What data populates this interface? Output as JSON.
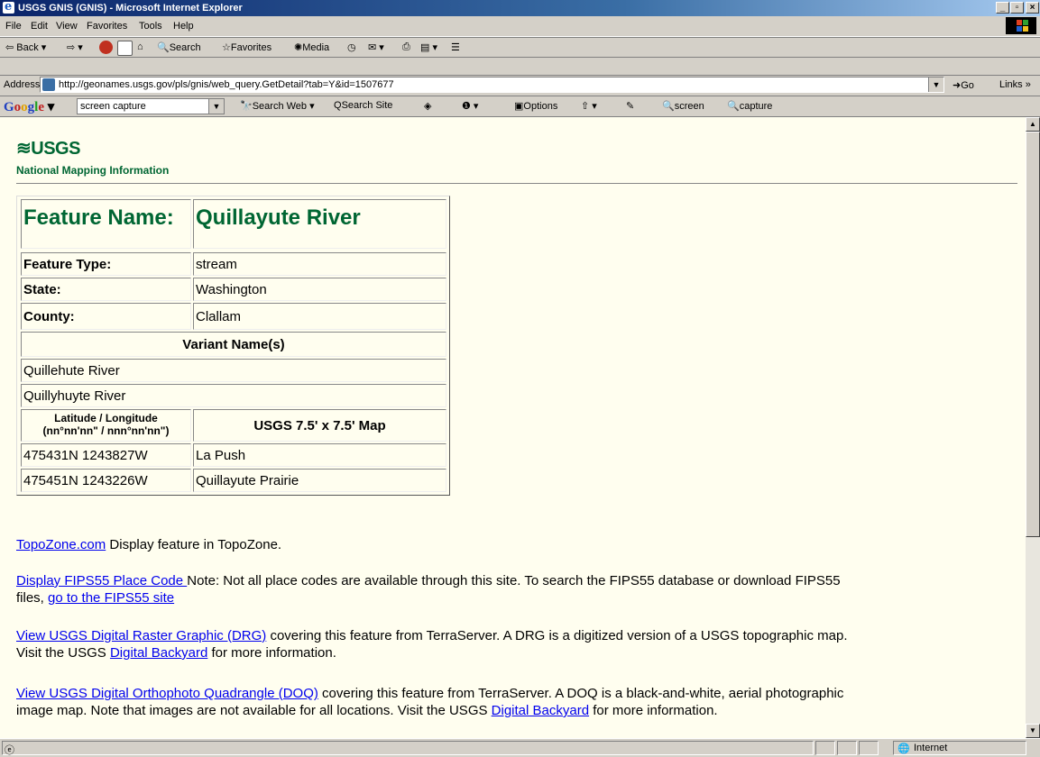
{
  "window": {
    "title": "USGS GNIS (GNIS) - Microsoft Internet Explorer"
  },
  "menu": [
    "File",
    "Edit",
    "View",
    "Favorites",
    "Tools",
    "Help"
  ],
  "toolbar": {
    "back": "Back",
    "search": "Search",
    "favorites": "Favorites",
    "media": "Media"
  },
  "address": {
    "label": "Address",
    "url": "http://geonames.usgs.gov/pls/gnis/web_query.GetDetail?tab=Y&id=1507677",
    "go": "Go",
    "links": "Links »"
  },
  "google": {
    "logo": "Google",
    "query": "screen capture",
    "search_web": "Search Web",
    "search_site": "Search Site",
    "options": "Options",
    "screen": "screen",
    "capture": "capture"
  },
  "page": {
    "logo": "≋USGS",
    "logo_sub": "National Mapping Information",
    "feature_name_label": "Feature Name:",
    "feature_name": "Quillayute River",
    "rows": [
      {
        "label": "Feature Type:",
        "value": "stream"
      },
      {
        "label": "State:",
        "value": "Washington"
      },
      {
        "label": "County:",
        "value": "Clallam"
      }
    ],
    "variant_header": "Variant Name(s)",
    "variants": [
      "Quillehute River",
      "Quillyhuyte River"
    ],
    "coord_header_1": "Latitude  /  Longitude",
    "coord_header_2": "(nn°nn'nn\" / nnn°nn'nn\")",
    "map_header": "USGS 7.5' x 7.5' Map",
    "coords": [
      {
        "latlon": "475431N 1243827W",
        "map": "La Push"
      },
      {
        "latlon": "475451N 1243226W",
        "map": "Quillayute Prairie"
      }
    ],
    "topozone_link": "TopoZone.com",
    "topozone_text": " Display feature in TopoZone.",
    "fips_link": "Display FIPS55 Place Code ",
    "fips_text": "Note: Not all place codes are available through this site. To search the FIPS55 database or download FIPS55",
    "fips_text2": "files, ",
    "fips_link2": "go to the FIPS55 site",
    "drg_link": "View USGS Digital Raster Graphic (DRG)",
    "drg_text": " covering this feature from TerraServer. A DRG is a digitized version of a USGS topographic map.",
    "drg_text2": "Visit the USGS ",
    "backyard_link": "Digital Backyard",
    "drg_text3": " for more information.",
    "doq_link": "View USGS Digital Orthophoto Quadrangle (DOQ)",
    "doq_text": " covering this feature from TerraServer. A DOQ is a black-and-white, aerial photographic",
    "doq_text2": "image map. Note that images are not available for all locations. Visit the USGS ",
    "doq_text3": " for more information."
  },
  "status": {
    "zone": "Internet"
  }
}
